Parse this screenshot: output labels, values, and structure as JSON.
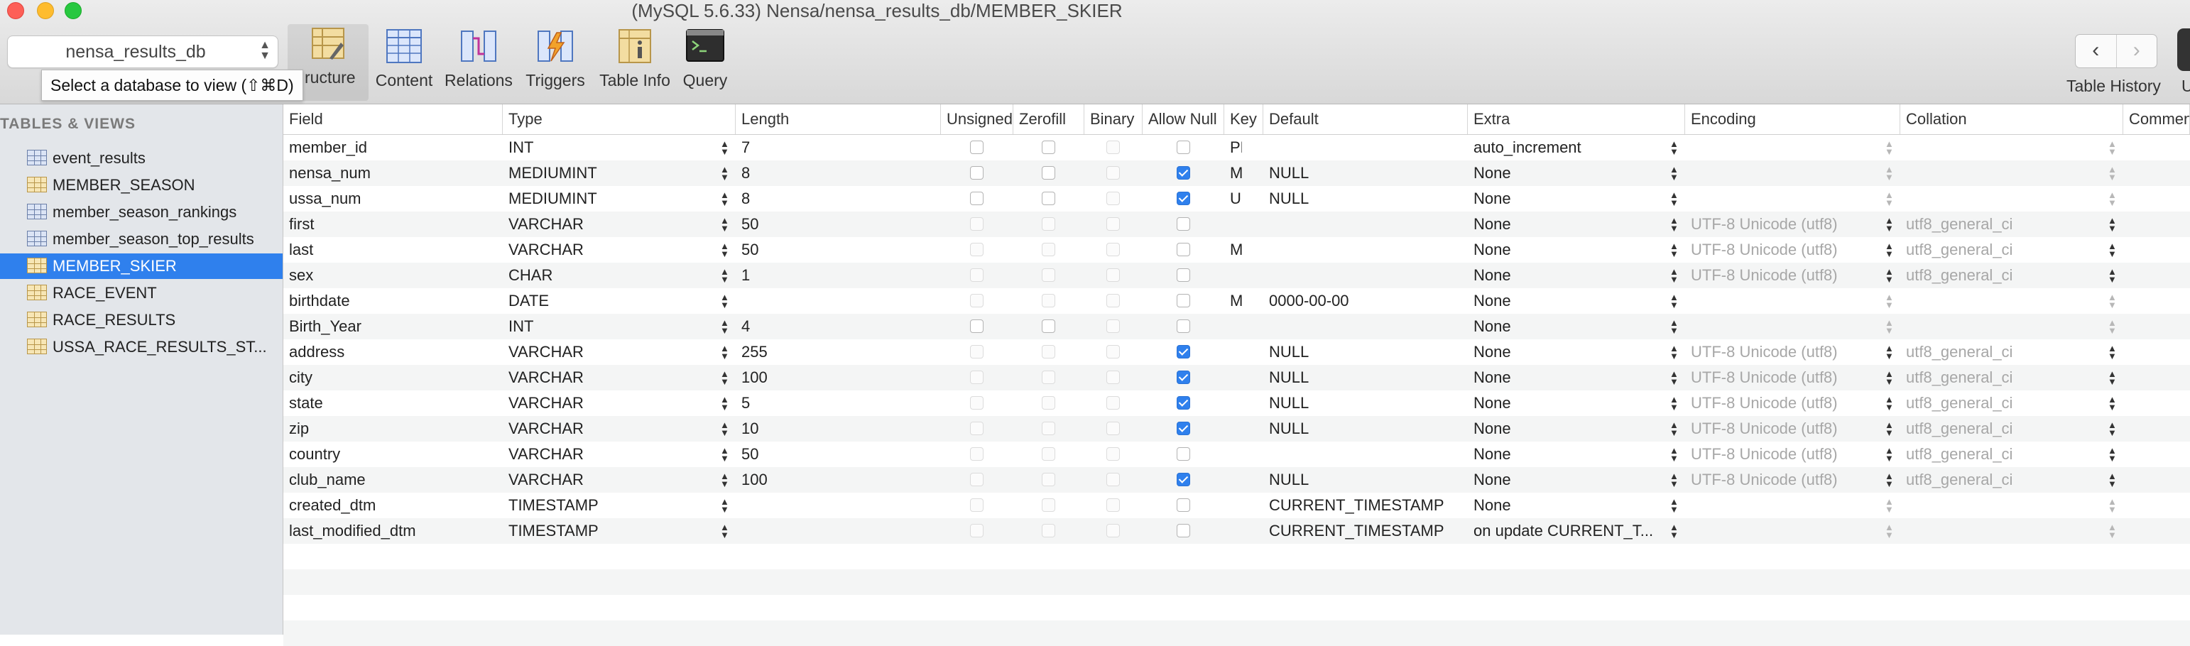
{
  "window": {
    "title": "(MySQL 5.6.33) Nensa/nensa_results_db/MEMBER_SKIER"
  },
  "toolbar": {
    "database_select": "nensa_results_db",
    "tooltip": "Select a database to view (⇧⌘D)",
    "tools": [
      {
        "label": "Structure",
        "visible_label": "ructure",
        "icon": "structure-icon",
        "active": true
      },
      {
        "label": "Content",
        "icon": "content-icon"
      },
      {
        "label": "Relations",
        "icon": "relations-icon"
      },
      {
        "label": "Triggers",
        "icon": "triggers-icon"
      },
      {
        "label": "Table Info",
        "icon": "table-info-icon"
      },
      {
        "label": "Query",
        "icon": "query-icon"
      }
    ],
    "history_label": "Table History",
    "back": "‹",
    "forward": "›",
    "user_label": "U"
  },
  "sidebar": {
    "heading": "TABLES & VIEWS",
    "items": [
      {
        "name": "event_results",
        "kind": "view"
      },
      {
        "name": "MEMBER_SEASON",
        "kind": "table"
      },
      {
        "name": "member_season_rankings",
        "kind": "view"
      },
      {
        "name": "member_season_top_results",
        "kind": "view"
      },
      {
        "name": "MEMBER_SKIER",
        "kind": "table",
        "selected": true
      },
      {
        "name": "RACE_EVENT",
        "kind": "table"
      },
      {
        "name": "RACE_RESULTS",
        "kind": "table"
      },
      {
        "name": "USSA_RACE_RESULTS_ST...",
        "kind": "table"
      }
    ]
  },
  "structure": {
    "columns": [
      "Field",
      "Type",
      "Length",
      "Unsigned",
      "Zerofill",
      "Binary",
      "Allow Null",
      "Key",
      "Default",
      "Extra",
      "Encoding",
      "Collation",
      "Comment"
    ],
    "rows": [
      {
        "field": "member_id",
        "type": "INT",
        "length": "7",
        "unsigned": false,
        "zerofill": false,
        "binary": false,
        "allow_null": false,
        "key": "PRI",
        "default": "",
        "extra": "auto_increment",
        "encoding": "",
        "collation": ""
      },
      {
        "field": "nensa_num",
        "type": "MEDIUMINT",
        "length": "8",
        "unsigned": false,
        "zerofill": false,
        "binary": false,
        "allow_null": true,
        "key": "M...",
        "default": "NULL",
        "extra": "None",
        "encoding": "",
        "collation": ""
      },
      {
        "field": "ussa_num",
        "type": "MEDIUMINT",
        "length": "8",
        "unsigned": false,
        "zerofill": false,
        "binary": false,
        "allow_null": true,
        "key": "UNI",
        "default": "NULL",
        "extra": "None",
        "encoding": "",
        "collation": ""
      },
      {
        "field": "first",
        "type": "VARCHAR",
        "length": "50",
        "unsigned": false,
        "zerofill": false,
        "binary": false,
        "allow_null": false,
        "key": "",
        "default": "",
        "extra": "None",
        "encoding": "UTF-8 Unicode (utf8)",
        "collation": "utf8_general_ci"
      },
      {
        "field": "last",
        "type": "VARCHAR",
        "length": "50",
        "unsigned": false,
        "zerofill": false,
        "binary": false,
        "allow_null": false,
        "key": "M...",
        "default": "",
        "extra": "None",
        "encoding": "UTF-8 Unicode (utf8)",
        "collation": "utf8_general_ci"
      },
      {
        "field": "sex",
        "type": "CHAR",
        "length": "1",
        "unsigned": false,
        "zerofill": false,
        "binary": false,
        "allow_null": false,
        "key": "",
        "default": "",
        "extra": "None",
        "encoding": "UTF-8 Unicode (utf8)",
        "collation": "utf8_general_ci"
      },
      {
        "field": "birthdate",
        "type": "DATE",
        "length": "",
        "unsigned": false,
        "zerofill": false,
        "binary": false,
        "allow_null": false,
        "key": "M...",
        "default": "0000-00-00",
        "extra": "None",
        "encoding": "",
        "collation": ""
      },
      {
        "field": "Birth_Year",
        "type": "INT",
        "length": "4",
        "unsigned": false,
        "zerofill": false,
        "binary": false,
        "allow_null": false,
        "key": "",
        "default": "",
        "extra": "None",
        "encoding": "",
        "collation": ""
      },
      {
        "field": "address",
        "type": "VARCHAR",
        "length": "255",
        "unsigned": false,
        "zerofill": false,
        "binary": false,
        "allow_null": true,
        "key": "",
        "default": "NULL",
        "extra": "None",
        "encoding": "UTF-8 Unicode (utf8)",
        "collation": "utf8_general_ci"
      },
      {
        "field": "city",
        "type": "VARCHAR",
        "length": "100",
        "unsigned": false,
        "zerofill": false,
        "binary": false,
        "allow_null": true,
        "key": "",
        "default": "NULL",
        "extra": "None",
        "encoding": "UTF-8 Unicode (utf8)",
        "collation": "utf8_general_ci"
      },
      {
        "field": "state",
        "type": "VARCHAR",
        "length": "5",
        "unsigned": false,
        "zerofill": false,
        "binary": false,
        "allow_null": true,
        "key": "",
        "default": "NULL",
        "extra": "None",
        "encoding": "UTF-8 Unicode (utf8)",
        "collation": "utf8_general_ci"
      },
      {
        "field": "zip",
        "type": "VARCHAR",
        "length": "10",
        "unsigned": false,
        "zerofill": false,
        "binary": false,
        "allow_null": true,
        "key": "",
        "default": "NULL",
        "extra": "None",
        "encoding": "UTF-8 Unicode (utf8)",
        "collation": "utf8_general_ci"
      },
      {
        "field": "country",
        "type": "VARCHAR",
        "length": "50",
        "unsigned": false,
        "zerofill": false,
        "binary": false,
        "allow_null": false,
        "key": "",
        "default": "",
        "extra": "None",
        "encoding": "UTF-8 Unicode (utf8)",
        "collation": "utf8_general_ci"
      },
      {
        "field": "club_name",
        "type": "VARCHAR",
        "length": "100",
        "unsigned": false,
        "zerofill": false,
        "binary": false,
        "allow_null": true,
        "key": "",
        "default": "NULL",
        "extra": "None",
        "encoding": "UTF-8 Unicode (utf8)",
        "collation": "utf8_general_ci"
      },
      {
        "field": "created_dtm",
        "type": "TIMESTAMP",
        "length": "",
        "unsigned": false,
        "zerofill": false,
        "binary": false,
        "allow_null": false,
        "key": "",
        "default": "CURRENT_TIMESTAMP",
        "extra": "None",
        "encoding": "",
        "collation": ""
      },
      {
        "field": "last_modified_dtm",
        "type": "TIMESTAMP",
        "length": "",
        "unsigned": false,
        "zerofill": false,
        "binary": false,
        "allow_null": false,
        "key": "",
        "default": "CURRENT_TIMESTAMP",
        "extra": "on update CURRENT_T...",
        "encoding": "",
        "collation": ""
      }
    ]
  },
  "colors": {
    "selection": "#2f80ed",
    "sidebar_bg": "#e3e6ea",
    "row_alt": "#f4f5f5",
    "disabled_text": "#a7a7a7"
  }
}
